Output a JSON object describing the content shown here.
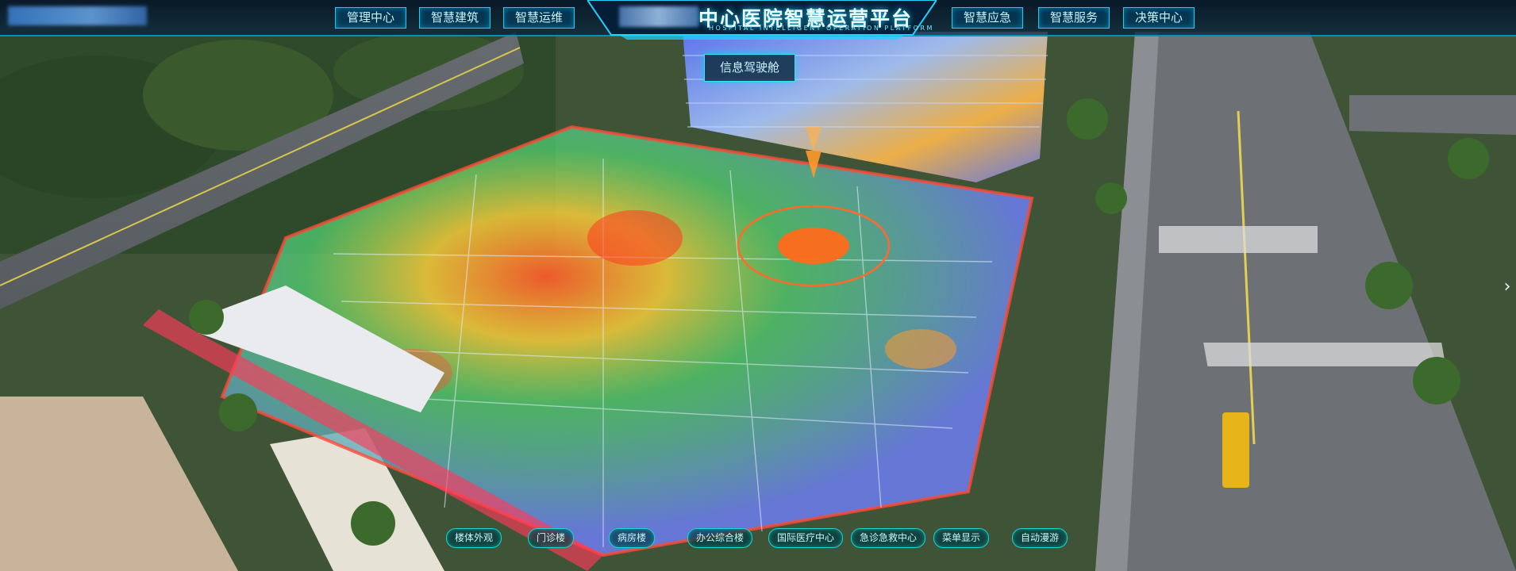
{
  "header": {
    "title": "中心医院智慧运营平台",
    "subtitle": "HOSPITAL INTELLIGENT OPERATION PLATFORM",
    "nav_left": [
      "管理中心",
      "智慧建筑",
      "智慧运维"
    ],
    "nav_right": [
      "智慧应急",
      "智慧服务",
      "决策中心"
    ]
  },
  "scene": {
    "tooltip": "信息驾驶舱"
  },
  "bottom_nav": [
    "楼体外观",
    "门诊楼",
    "病房楼",
    "办公综合楼",
    "国际医疗中心",
    "急诊急救中心",
    "菜单显示",
    "自动漫游"
  ],
  "side_arrow_icon": "chevron-right-icon",
  "colors": {
    "accent": "#19cfe9",
    "title_glow": "#1bd3ff"
  }
}
